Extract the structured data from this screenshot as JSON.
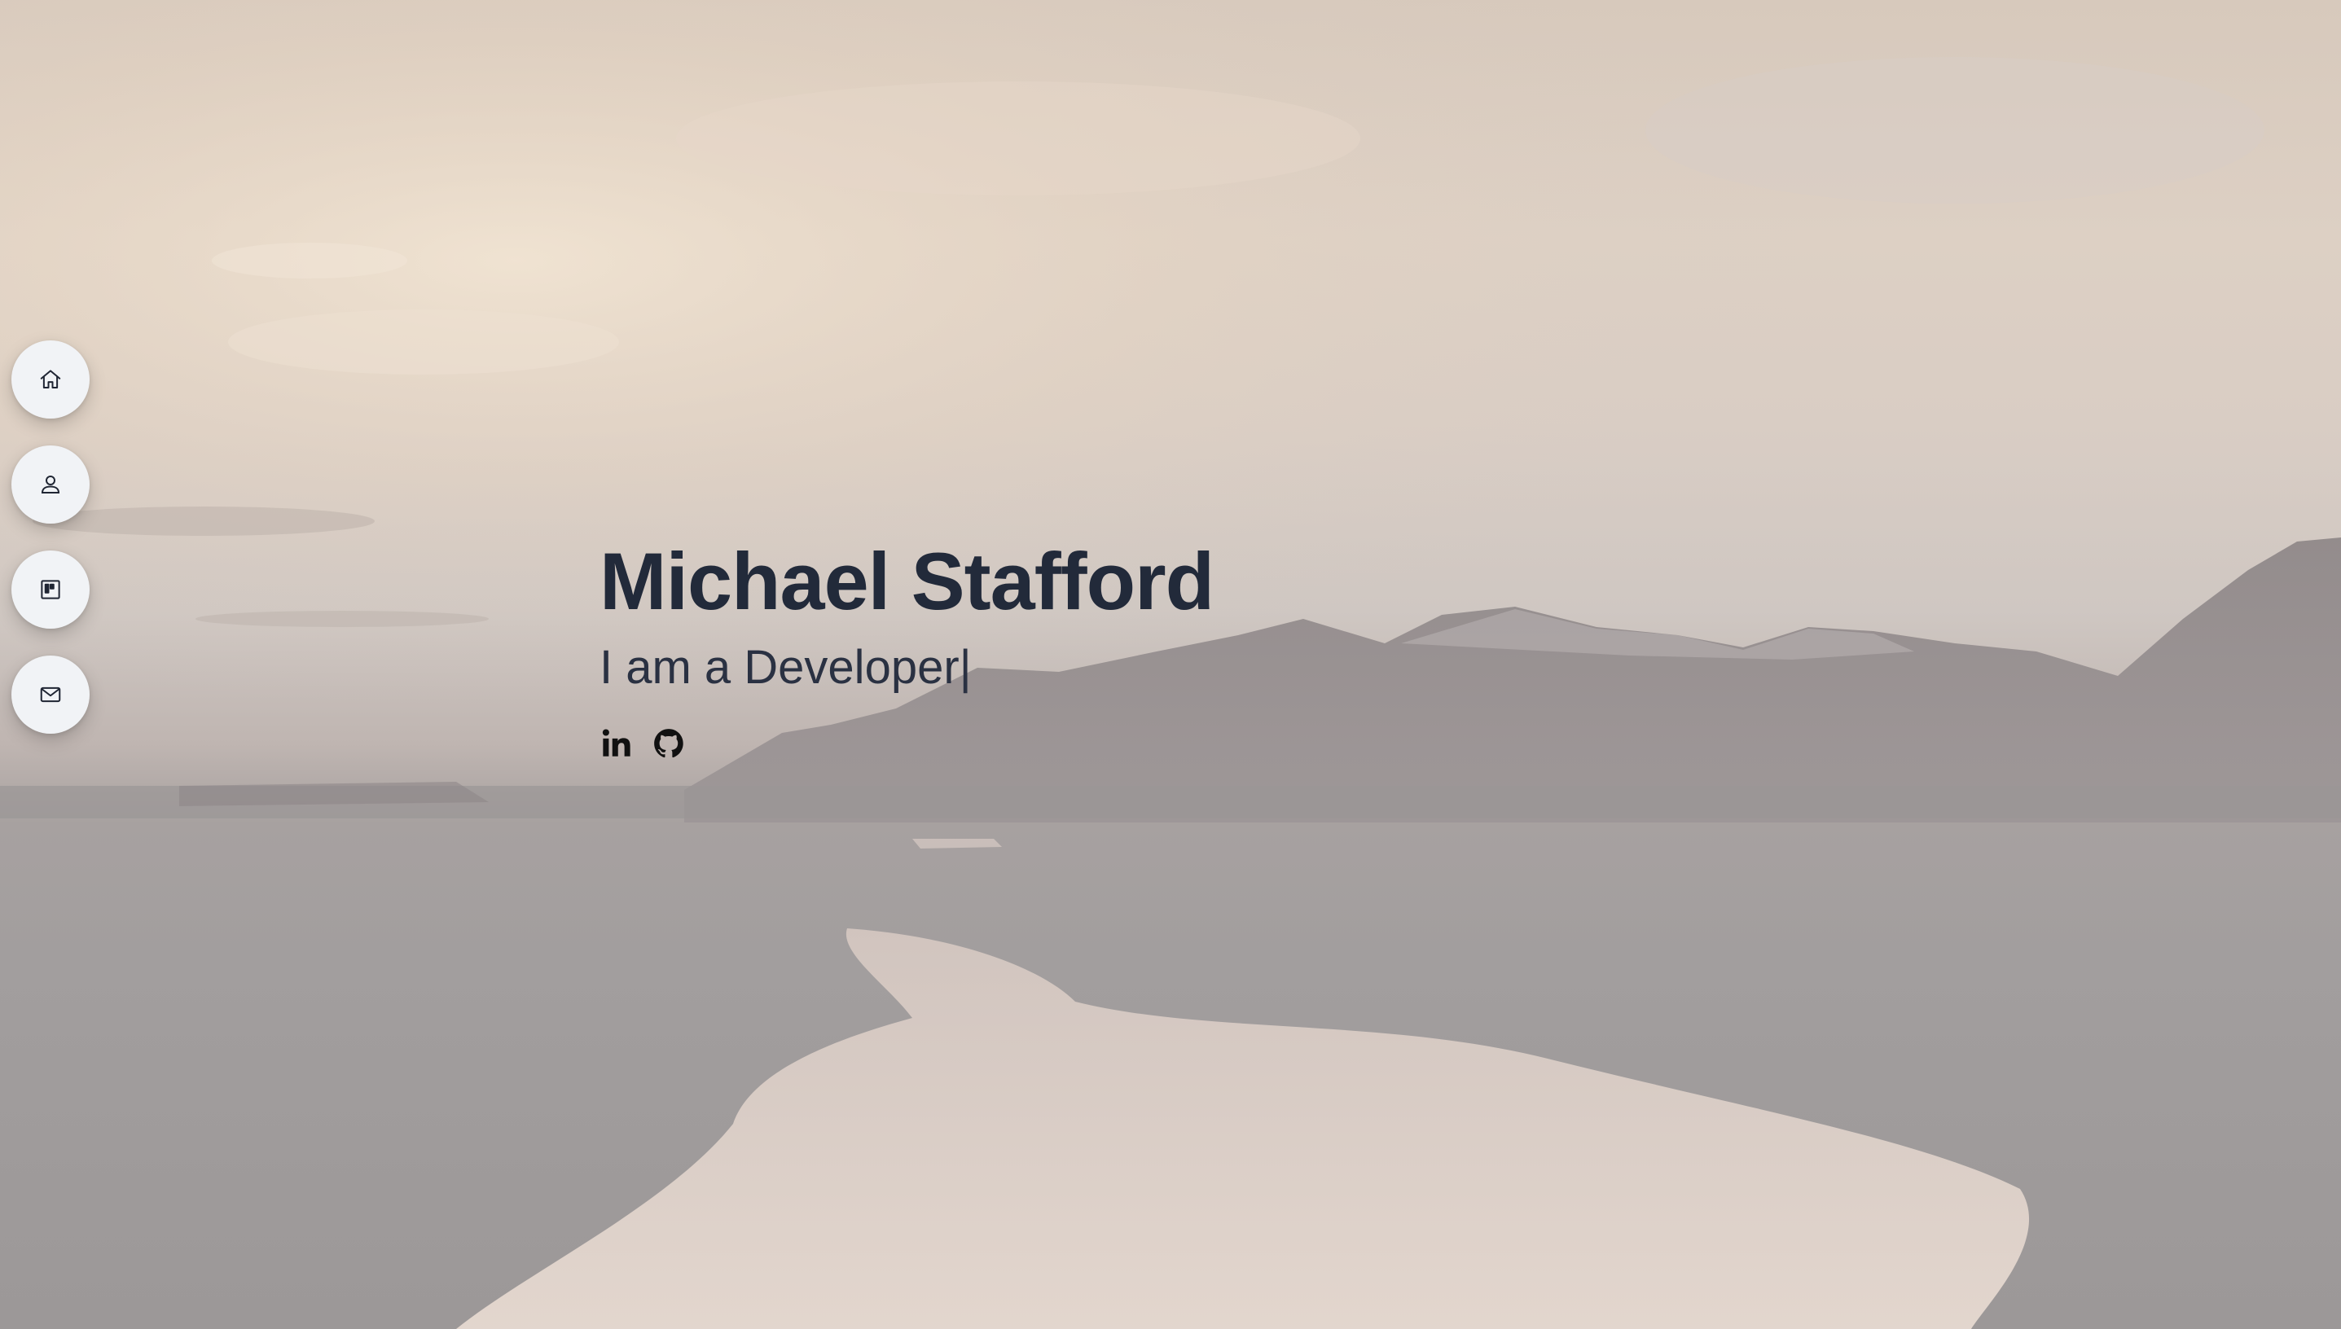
{
  "hero": {
    "name": "Michael Stafford",
    "tagline": "I am a Developer",
    "cursor": "|"
  },
  "nav": {
    "items": [
      {
        "icon": "home-icon"
      },
      {
        "icon": "user-icon"
      },
      {
        "icon": "portfolio-icon"
      },
      {
        "icon": "mail-icon"
      }
    ]
  },
  "socials": [
    {
      "icon": "linkedin-icon"
    },
    {
      "icon": "github-icon"
    }
  ],
  "colors": {
    "heading": "#222a3a",
    "nav_button_bg": "#f1f3f6",
    "icon": "#1f2533"
  }
}
